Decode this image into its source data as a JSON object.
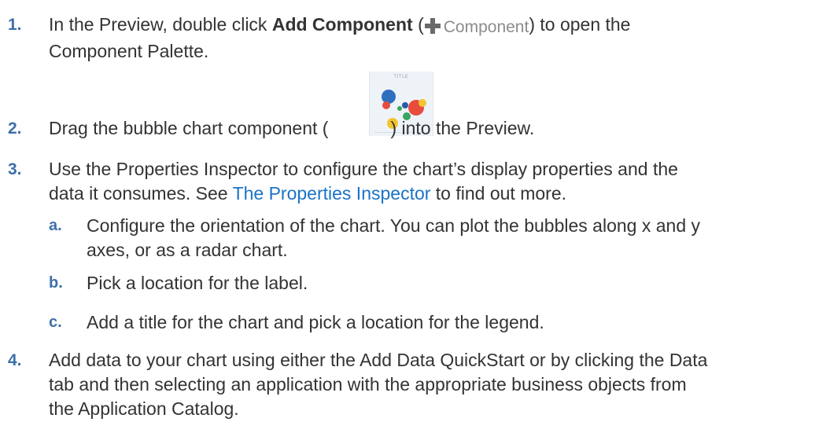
{
  "steps": [
    {
      "num": "1.",
      "pre": "In the Preview, double click ",
      "bold": "Add Component",
      "open": " (",
      "button_label": "Component",
      "close": ") to open the",
      "line2": "Component Palette."
    },
    {
      "num": "2.",
      "pre": "Drag the bubble chart component (",
      "post": ") into the Preview."
    },
    {
      "num": "3.",
      "line1": "Use the Properties Inspector to configure the chart’s display properties and the",
      "pre": "data it consumes. See ",
      "link": "The Properties Inspector",
      "post": " to find out more."
    },
    {
      "num": "4.",
      "line1": "Add data to your chart using either the Add Data QuickStart or by clicking the Data",
      "line2": "tab and then selecting an application with the appropriate business objects from",
      "line3": "the Application Catalog."
    }
  ],
  "substeps": [
    {
      "num": "a.",
      "line1": "Configure the orientation of the chart. You can plot the bubbles along x and y",
      "line2": "axes, or as a radar chart."
    },
    {
      "num": "b.",
      "line1": "Pick a location for the label."
    },
    {
      "num": "c.",
      "line1": "Add a title for the chart and pick a location for the legend."
    }
  ],
  "thumbnail": {
    "title": "TITLE",
    "bubble_colors": [
      "#2f6fc0",
      "#e84c3d",
      "#f3c530",
      "#3aa55d"
    ]
  },
  "icons": {
    "add_component": "plus-icon",
    "bubble_chart": "bubble-chart-icon"
  }
}
